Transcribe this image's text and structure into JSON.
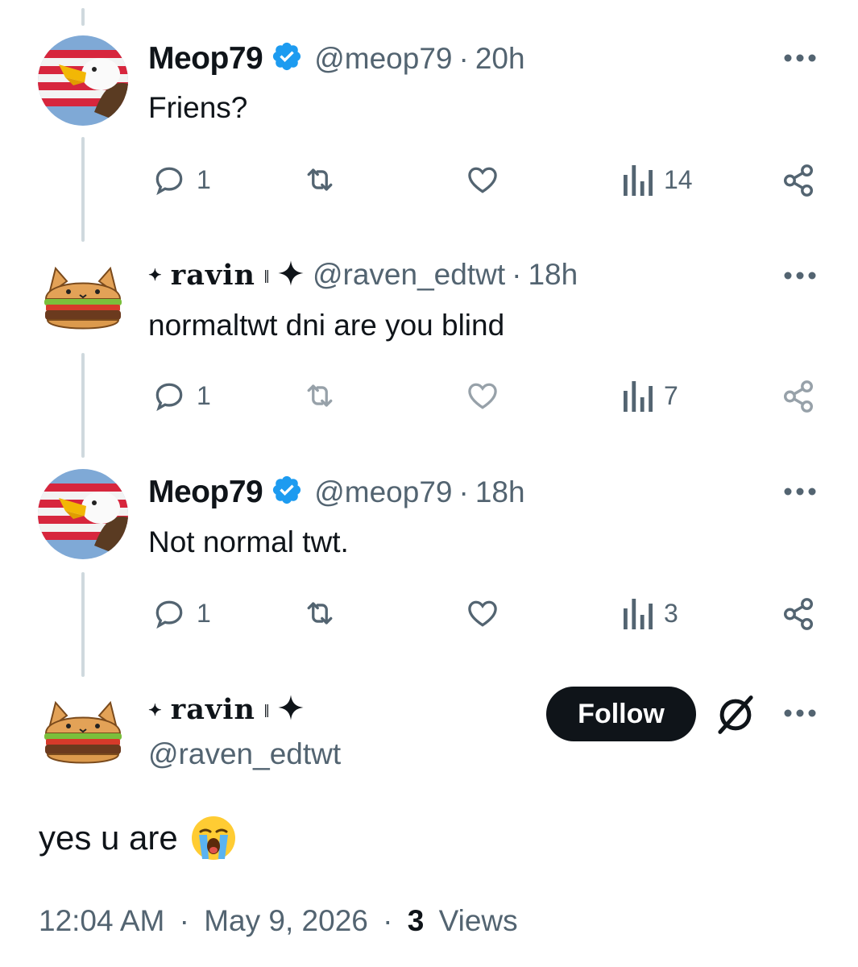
{
  "tweets": [
    {
      "display_name": "Meop79",
      "verified": true,
      "handle": "@meop79",
      "time": "20h",
      "text": "Friens?",
      "replies": "1",
      "views": "14",
      "avatar": "eagle-flag-avatar"
    },
    {
      "display_name": "ravin",
      "handle": "@raven_edtwt",
      "time": "18h",
      "text": "normaltwt dni are you blind",
      "replies": "1",
      "views": "7",
      "avatar": "burger-cat-avatar"
    },
    {
      "display_name": "Meop79",
      "verified": true,
      "handle": "@meop79",
      "time": "18h",
      "text": "Not normal twt.",
      "replies": "1",
      "views": "3",
      "avatar": "eagle-flag-avatar"
    }
  ],
  "main_tweet": {
    "display_name": "ravin",
    "handle": "@raven_edtwt",
    "follow_label": "Follow",
    "text": "yes u are",
    "emoji": "loudly-crying-face",
    "time": "12:04 AM",
    "date": "May 9, 2026",
    "views_count": "3",
    "views_label": "Views",
    "separator": "·"
  },
  "colors": {
    "text": "#0f1419",
    "secondary": "#536471",
    "verified": "#1d9bf0",
    "thread_line": "#cfd9de",
    "follow_bg": "#0f1419"
  }
}
